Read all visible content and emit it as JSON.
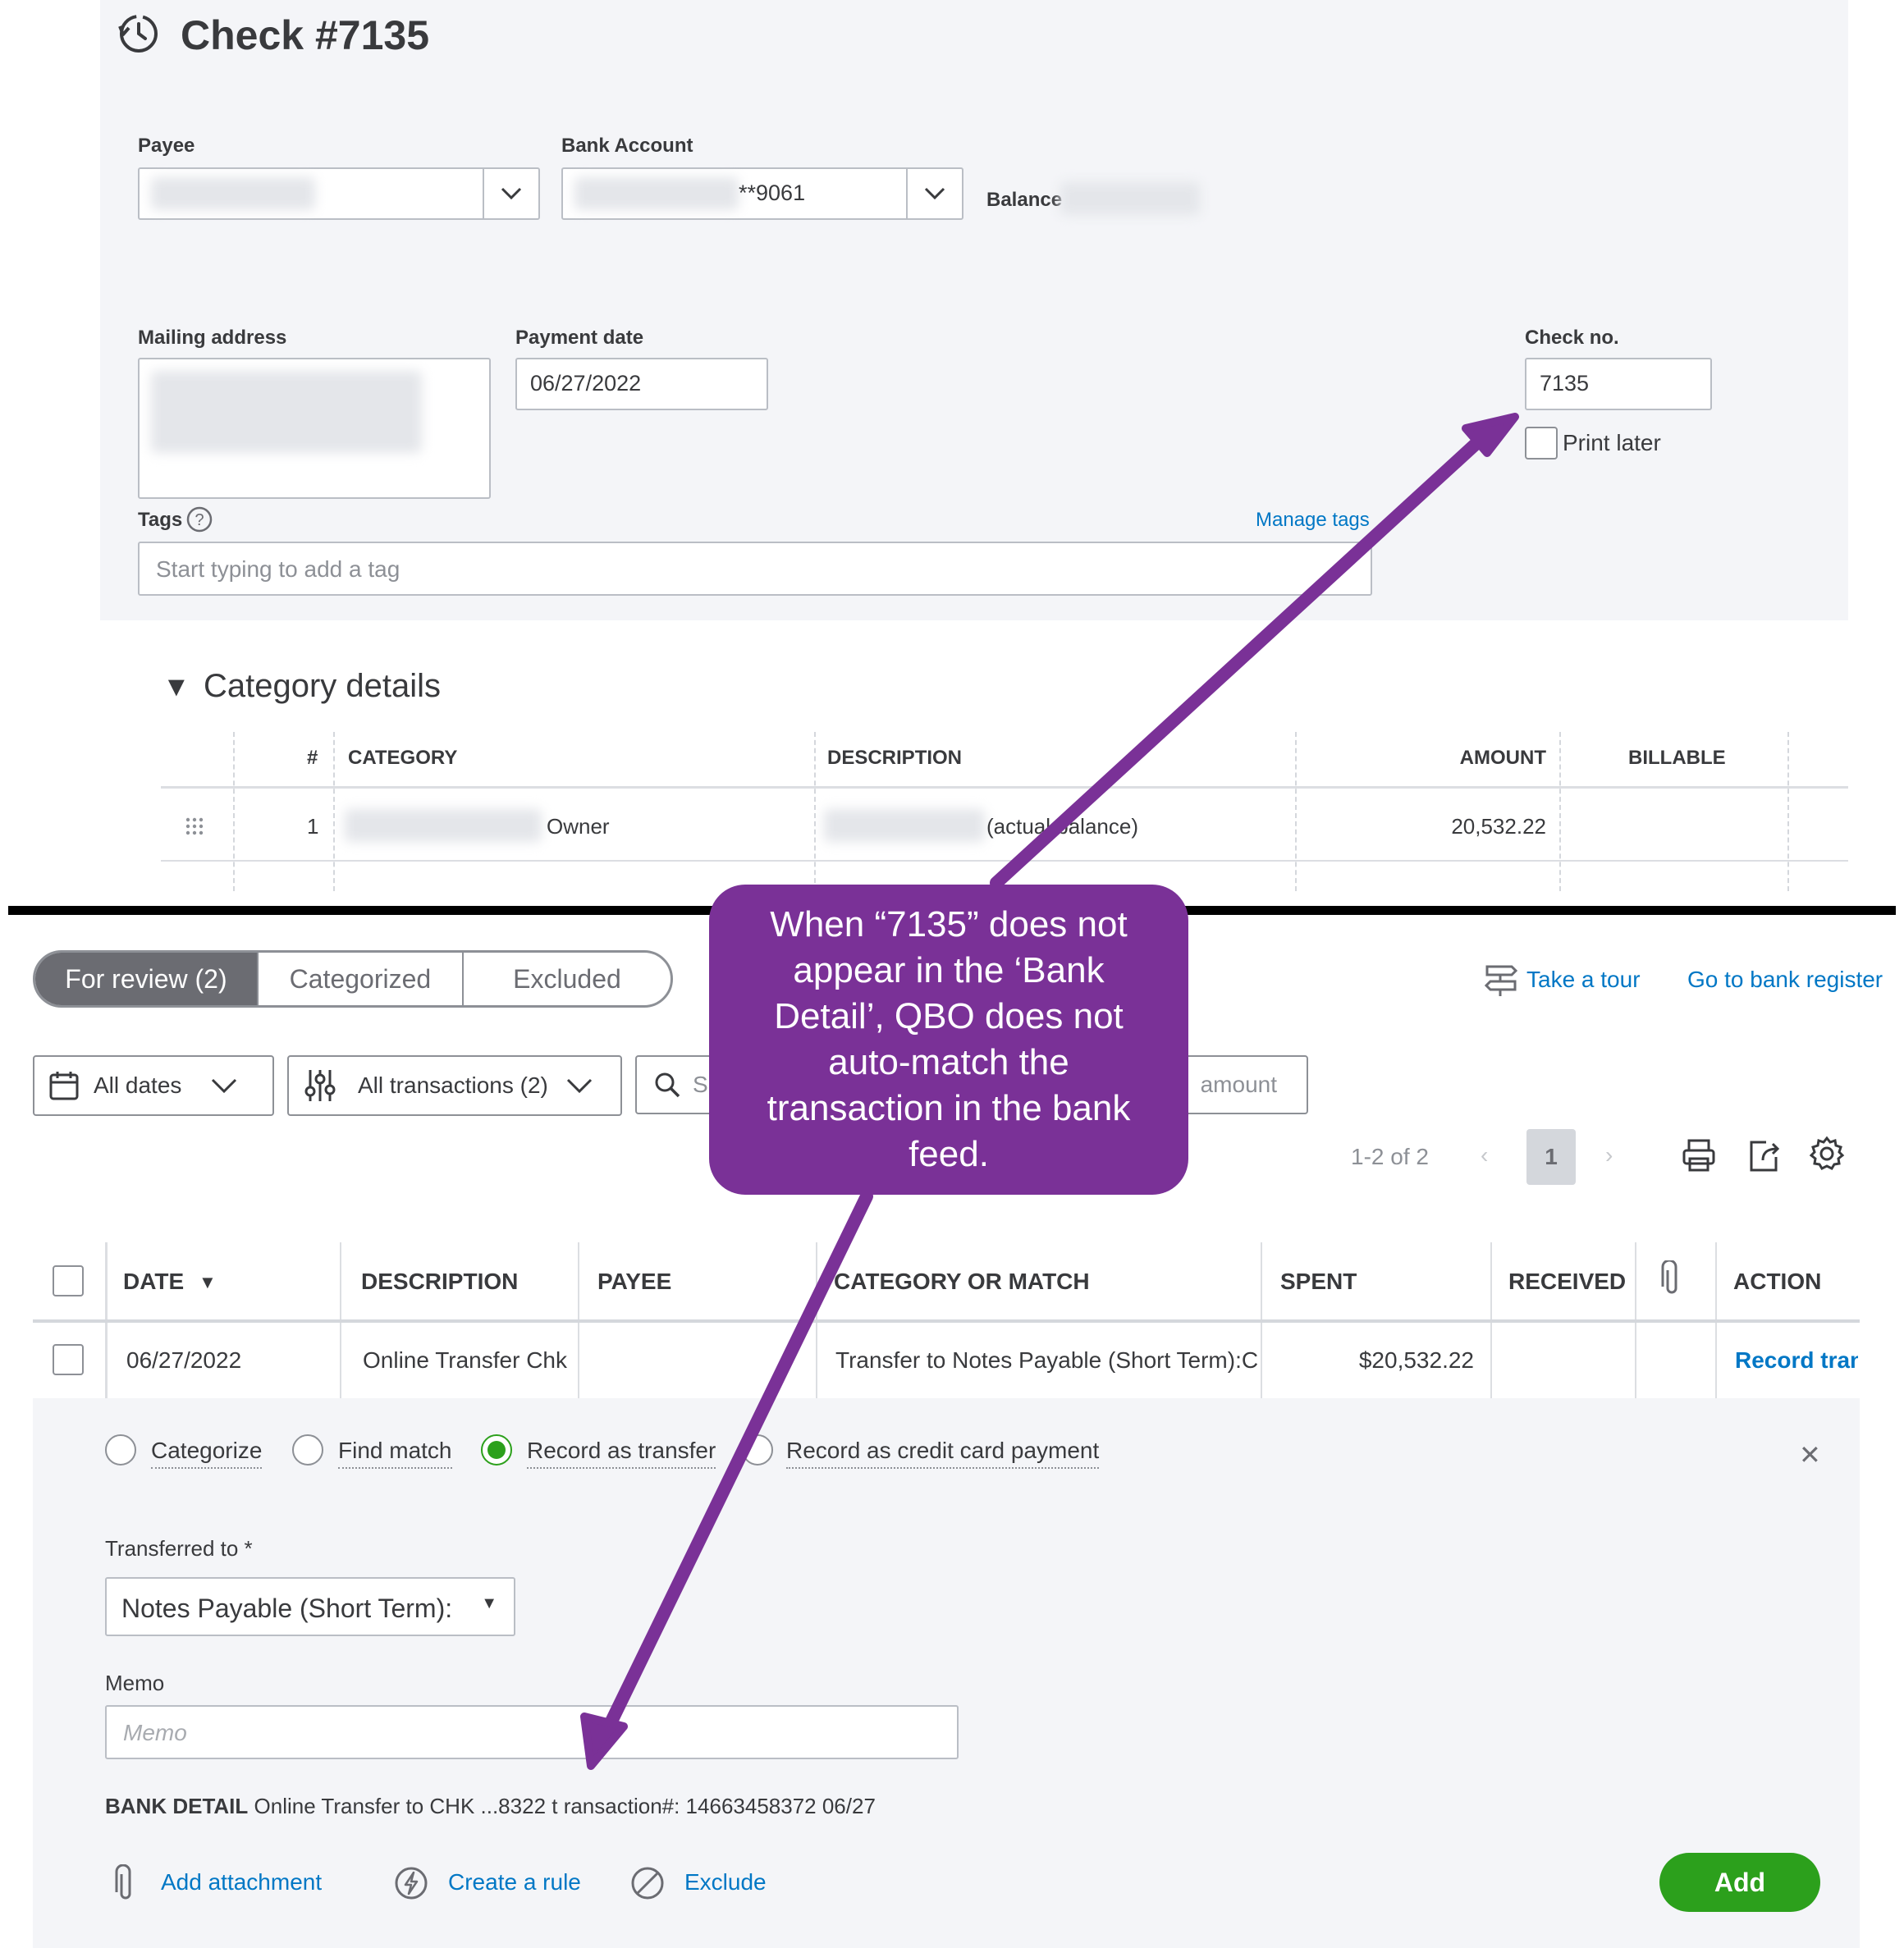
{
  "check": {
    "title": "Check #7135",
    "payee_label": "Payee",
    "bank_account_label": "Bank Account",
    "bank_account_value": "**9061",
    "balance_label": "Balance",
    "mailing_address_label": "Mailing address",
    "payment_date_label": "Payment date",
    "payment_date_value": "06/27/2022",
    "check_no_label": "Check no.",
    "check_no_value": "7135",
    "print_later_label": "Print later",
    "tags_label": "Tags",
    "manage_tags": "Manage tags",
    "tags_placeholder": "Start typing to add a tag"
  },
  "category_details": {
    "title": "Category details",
    "headers": [
      "#",
      "CATEGORY",
      "DESCRIPTION",
      "AMOUNT",
      "BILLABLE"
    ],
    "rows": [
      {
        "num": "1",
        "category": "Owner",
        "description": "(actual balance)",
        "amount": "20,532.22"
      }
    ]
  },
  "bank_feed": {
    "tabs": [
      "For review (2)",
      "Categorized",
      "Excluded"
    ],
    "take_tour": "Take a tour",
    "bank_register": "Go to bank register",
    "filters": {
      "dates": "All dates",
      "transactions": "All transactions (2)",
      "search_placeholder_start": "S",
      "search_placeholder_end": "amount"
    },
    "pagination": {
      "range": "1-2 of 2",
      "page": "1"
    },
    "headers": [
      "DATE",
      "DESCRIPTION",
      "PAYEE",
      "CATEGORY OR MATCH",
      "SPENT",
      "RECEIVED",
      "ACTION"
    ],
    "row": {
      "date": "06/27/2022",
      "description": "Online Transfer Chk",
      "category": "Transfer to Notes Payable (Short Term):Ca",
      "spent": "$20,532.22",
      "action": "Record tran"
    },
    "options": [
      "Categorize",
      "Find match",
      "Record as transfer",
      "Record as credit card payment"
    ],
    "transferred_to_label": "Transferred to *",
    "transferred_to_value": "Notes Payable (Short Term):",
    "memo_label": "Memo",
    "memo_placeholder": "Memo",
    "bank_detail_label": "BANK DETAIL",
    "bank_detail_value": "Online Transfer to CHK ...8322 t ransaction#: 14663458372 06/27",
    "add_attachment": "Add attachment",
    "create_rule": "Create a rule",
    "exclude": "Exclude",
    "add_button": "Add"
  },
  "annotation": {
    "text": "When “7135” does not appear in the ‘Bank Detail’, QBO does not auto-match the transaction in the bank feed.",
    "color": "#7a3197"
  },
  "colors": {
    "accent_green": "#2ca01c",
    "link_blue": "#0077c5"
  }
}
